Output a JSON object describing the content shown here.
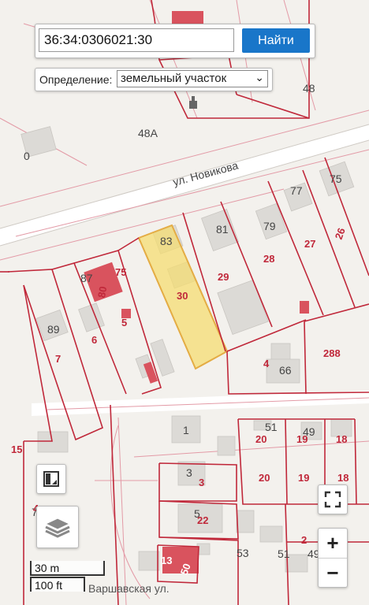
{
  "search": {
    "value": "36:34:0306021:30",
    "button_label": "Найти"
  },
  "definition": {
    "label": "Определение:",
    "selected": "земельный участок"
  },
  "map": {
    "street_labels": [
      "ул. Новикова",
      "Варшавская ул."
    ],
    "black_labels": [
      "48",
      "48А",
      "0",
      "77",
      "75",
      "81",
      "79",
      "83",
      "87",
      "89",
      "1",
      "51",
      "49",
      "3",
      "5",
      "53",
      "51",
      "49",
      "66",
      "7"
    ],
    "red_labels": [
      "26",
      "27",
      "28",
      "29",
      "30",
      "80",
      "75",
      "5",
      "6",
      "7",
      "4",
      "288",
      "15",
      "20",
      "19",
      "18",
      "20",
      "19",
      "18",
      "3",
      "22",
      "2",
      "13",
      "50",
      "4"
    ],
    "highlight_color": "#f5dc6e",
    "parcel_color": "#c0283a"
  },
  "controls": {
    "cadastral_icon": "cadastral-map-icon",
    "layers_icon": "layers-icon",
    "fullscreen_icon": "fullscreen-icon",
    "zoom_in_label": "+",
    "zoom_out_label": "−"
  },
  "scale": {
    "metric": "30 m",
    "imperial": "100 ft"
  }
}
